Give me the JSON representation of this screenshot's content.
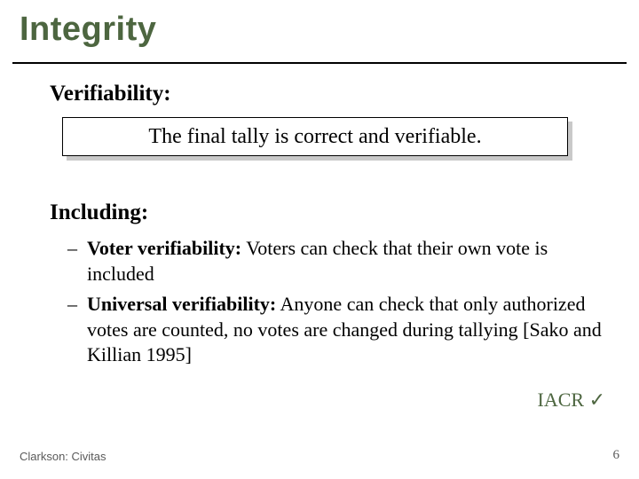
{
  "title": "Integrity",
  "verifiability_label": "Verifiability:",
  "box_text": "The final tally is correct and verifiable.",
  "including_label": "Including:",
  "bullets": [
    {
      "term": "Voter verifiability:",
      "text": " Voters can check that their own vote is included"
    },
    {
      "term": "Universal verifiability:",
      "text": " Anyone can check that only authorized votes are counted, no votes are changed during tallying [Sako and Killian 1995]"
    }
  ],
  "iacr_label": "IACR",
  "checkmark": "✓",
  "footer_left": "Clarkson: Civitas",
  "page_number": "6"
}
